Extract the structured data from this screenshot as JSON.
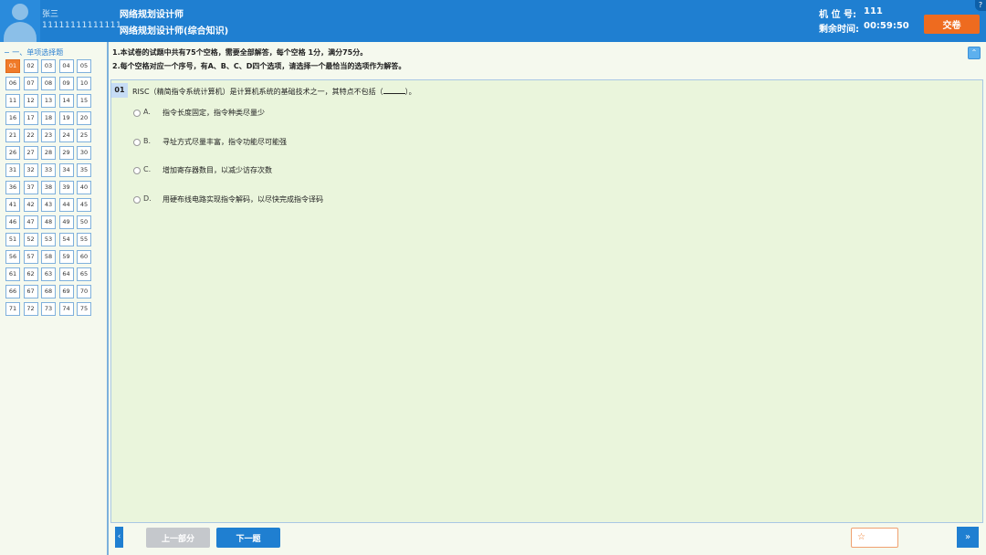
{
  "header": {
    "user_name": "张三",
    "user_id": "11111111111111",
    "exam_title": "网络规划设计师",
    "exam_subtitle": "网络规划设计师(综合知识)",
    "seat_label": "机 位 号:",
    "seat_value": "111",
    "time_label": "剩余时间:",
    "time_value": "00:59:50",
    "submit_label": "交卷",
    "help_label": "?"
  },
  "sidebar": {
    "section_title": "一、单项选择题",
    "active_question": "01",
    "questions": [
      "01",
      "02",
      "03",
      "04",
      "05",
      "06",
      "07",
      "08",
      "09",
      "10",
      "11",
      "12",
      "13",
      "14",
      "15",
      "16",
      "17",
      "18",
      "19",
      "20",
      "21",
      "22",
      "23",
      "24",
      "25",
      "26",
      "27",
      "28",
      "29",
      "30",
      "31",
      "32",
      "33",
      "34",
      "35",
      "36",
      "37",
      "38",
      "39",
      "40",
      "41",
      "42",
      "43",
      "44",
      "45",
      "46",
      "47",
      "48",
      "49",
      "50",
      "51",
      "52",
      "53",
      "54",
      "55",
      "56",
      "57",
      "58",
      "59",
      "60",
      "61",
      "62",
      "63",
      "64",
      "65",
      "66",
      "67",
      "68",
      "69",
      "70",
      "71",
      "72",
      "73",
      "74",
      "75"
    ]
  },
  "instructions": {
    "line1": "1.本试卷的试题中共有75个空格，需要全部解答，每个空格 1分，满分75分。",
    "line2": "2.每个空格对应一个序号，有A、B、C、D四个选项，请选择一个最恰当的选项作为解答。"
  },
  "question": {
    "number": "01",
    "stem_before": "RISC（精简指令系统计算机）是计算机系统的基础技术之一，其特点不包括（",
    "stem_after": "）。",
    "options": [
      {
        "letter": "A.",
        "text": "指令长度固定，指令种类尽量少"
      },
      {
        "letter": "B.",
        "text": "寻址方式尽量丰富，指令功能尽可能强"
      },
      {
        "letter": "C.",
        "text": "增加寄存器数目，以减少访存次数"
      },
      {
        "letter": "D.",
        "text": "用硬布线电路实现指令解码，以尽快完成指令译码"
      }
    ]
  },
  "navigation": {
    "prev_label": "上一部分",
    "next_label": "下一题",
    "mark_icon": "☆"
  },
  "colors": {
    "header_blue": "#1f7fd1",
    "accent_orange": "#ee6b1f",
    "panel_green": "#eaf5dc"
  }
}
